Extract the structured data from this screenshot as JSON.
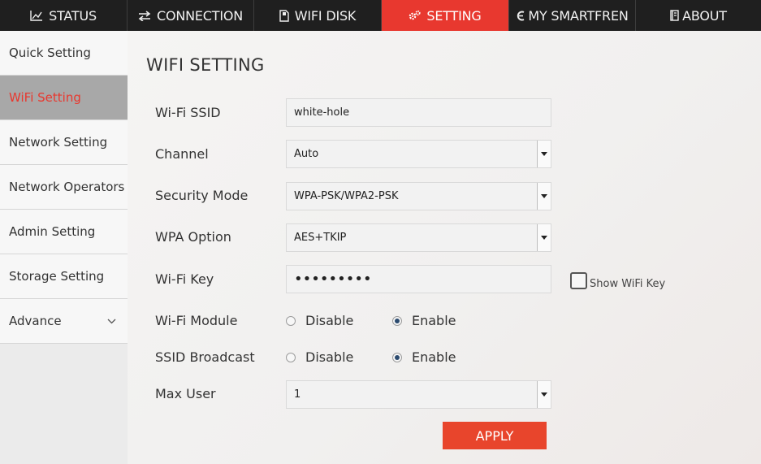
{
  "topnav": {
    "tabs": [
      {
        "label": "STATUS",
        "icon": "chart-line-icon"
      },
      {
        "label": "CONNECTION",
        "icon": "swap-arrows-icon"
      },
      {
        "label": "WIFI DISK",
        "icon": "sd-card-icon"
      },
      {
        "label": "SETTING",
        "icon": "gears-icon"
      },
      {
        "label": "MY SMARTFREN",
        "icon": "smartfren-logo-icon"
      },
      {
        "label": "ABOUT",
        "icon": "book-icon"
      }
    ],
    "active_index": 3,
    "active_color": "#e8382f"
  },
  "sidebar": {
    "items": [
      {
        "label": "Quick Setting"
      },
      {
        "label": "WiFi Setting"
      },
      {
        "label": "Network Setting"
      },
      {
        "label": "Network Operators"
      },
      {
        "label": "Admin Setting"
      },
      {
        "label": "Storage Setting"
      },
      {
        "label": "Advance"
      }
    ],
    "active_index": 1
  },
  "main": {
    "title": "WIFI SETTING",
    "ssid": {
      "label": "Wi-Fi SSID",
      "value": "white-hole"
    },
    "channel": {
      "label": "Channel",
      "value": "Auto"
    },
    "security_mode": {
      "label": "Security Mode",
      "value": "WPA-PSK/WPA2-PSK"
    },
    "wpa_option": {
      "label": "WPA Option",
      "value": "AES+TKIP"
    },
    "wifi_key": {
      "label": "Wi-Fi Key",
      "masked_value": "•••••••••",
      "show_label": "Show WiFi Key",
      "show_checked": false
    },
    "wifi_module": {
      "label": "Wi-Fi Module",
      "options": [
        "Disable",
        "Enable"
      ],
      "selected": "Enable"
    },
    "ssid_broadcast": {
      "label": "SSID Broadcast",
      "options": [
        "Disable",
        "Enable"
      ],
      "selected": "Enable"
    },
    "max_user": {
      "label": "Max User",
      "value": "1"
    },
    "apply_label": "APPLY",
    "apply_color": "#e8452c"
  }
}
